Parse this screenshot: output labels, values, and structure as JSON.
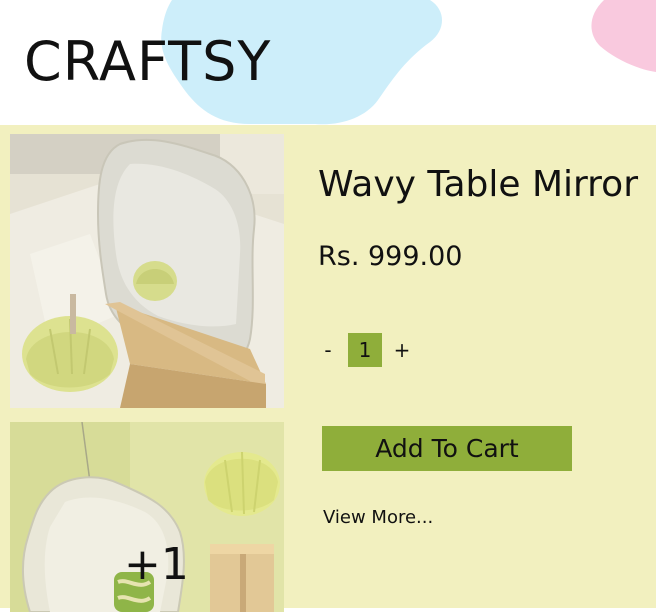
{
  "brand": {
    "logo_text": "CRAFTSY"
  },
  "product": {
    "title": "Wavy Table Mirror",
    "price": "Rs. 999.00",
    "quantity": {
      "decrement_label": "-",
      "value": "1",
      "increment_label": "+"
    },
    "add_to_cart_label": "Add To Cart",
    "view_more_label": "View More...",
    "more_images_label": "+1"
  },
  "colors": {
    "page_background": "#f2f0bf",
    "accent_green": "#8fae3a",
    "header_blob_blue": "#cdeefa",
    "header_blob_pink": "#f9c9de"
  }
}
